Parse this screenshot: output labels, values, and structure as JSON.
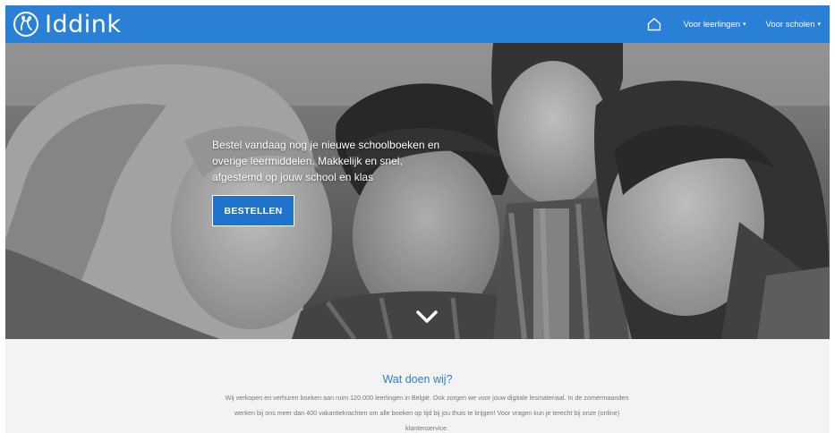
{
  "header": {
    "brand": "Iddink",
    "brand_icon": "iddink-logo-icon",
    "home_icon": "home-icon",
    "nav": [
      {
        "label": "Voor leerlingen"
      },
      {
        "label": "Voor scholen"
      }
    ],
    "colors": {
      "bar": "#2a7fd6",
      "text": "#ffffff"
    }
  },
  "hero": {
    "text": "Bestel vandaag nog je nieuwe schoolboeken en overige leermiddelen. Makkelijk en snel, afgestemd op jouw school en klas",
    "button_label": "BESTELLEN",
    "scroll_icon": "chevron-down-icon",
    "colors": {
      "button": "#1f73cc"
    }
  },
  "section": {
    "title": "Wat doen wij?",
    "body": "Wij verkopen en verhuren boeken aan ruim 120.000 leerlingen in België. Ook zorgen we voor jouw digitale lesmateriaal. In de zomermaanden werken bij ons meer dan 400 vakantiekrachten om alle boeken op tijd bij jou thuis te krijgen! Voor vragen kun je terecht bij onze (online) klantenservice.",
    "colors": {
      "title": "#2a7fd6",
      "body": "#777777"
    }
  }
}
